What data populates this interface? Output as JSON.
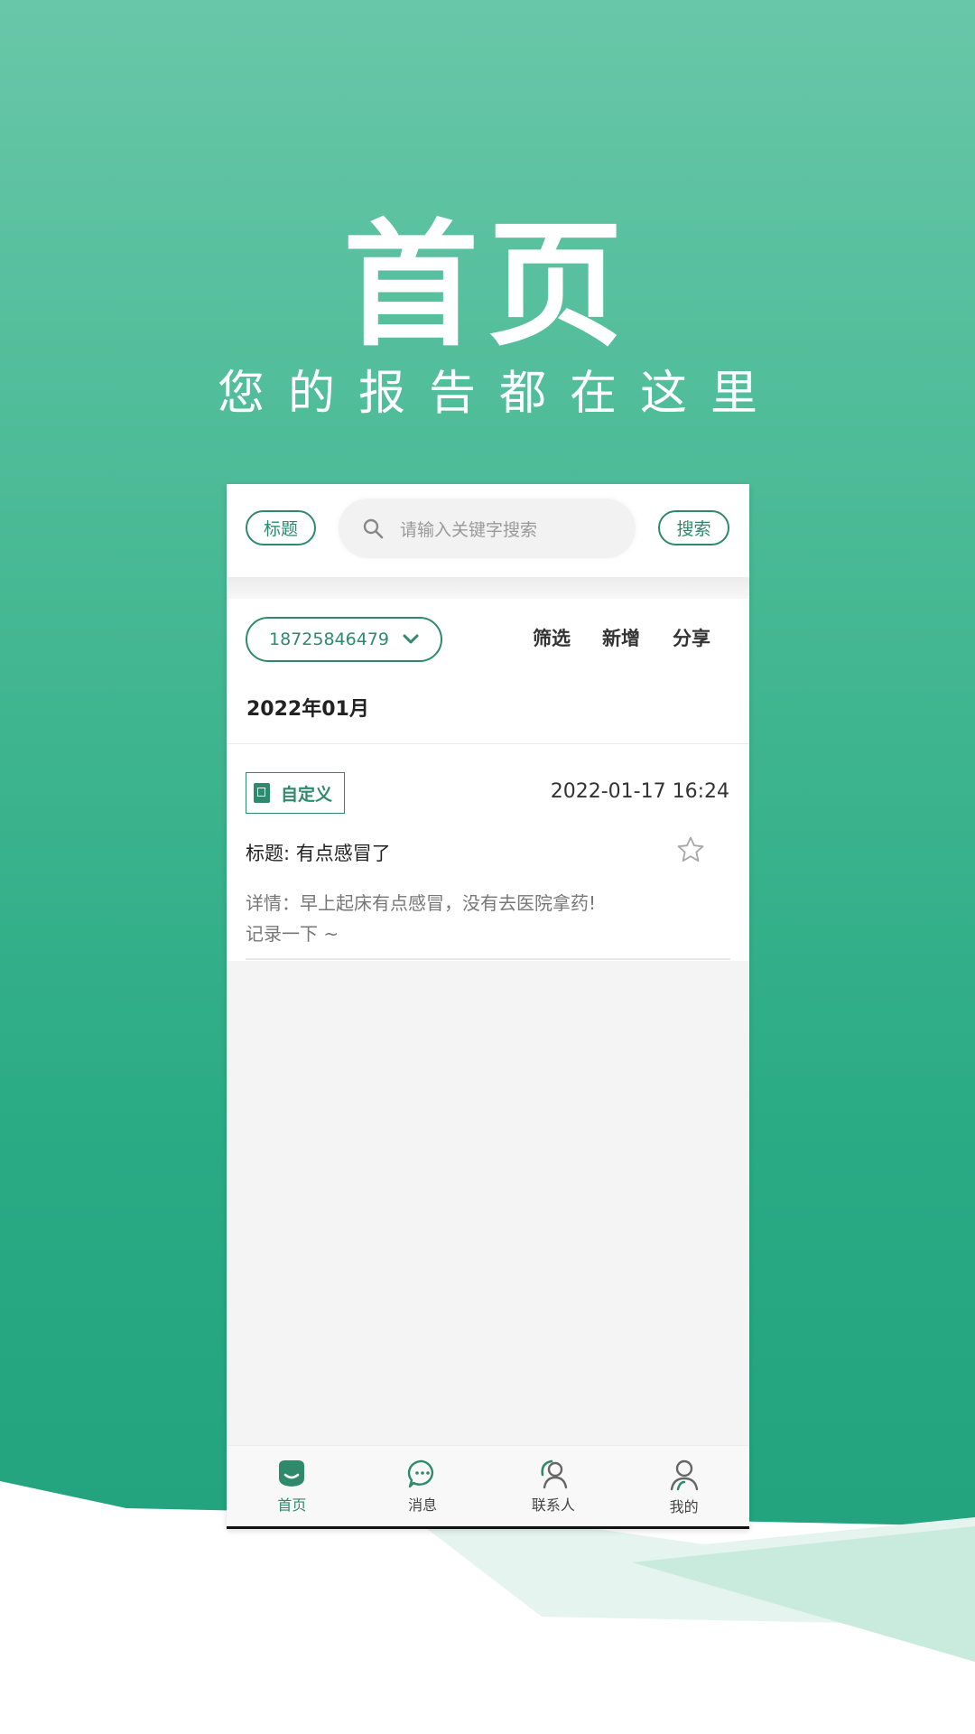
{
  "hero": {
    "title": "首页",
    "subtitle": "您的报告都在这里"
  },
  "search_bar": {
    "title_button": "标题",
    "placeholder": "请输入关键字搜索",
    "search_button": "搜索"
  },
  "filter_bar": {
    "phone_number": "18725846479",
    "actions": [
      "筛选",
      "新增",
      "分享"
    ]
  },
  "month": "2022年01月",
  "record": {
    "tag": "自定义",
    "time": "2022-01-17 16:24",
    "title": "标题: 有点感冒了",
    "detail_line1": "详情：早上起床有点感冒，没有去医院拿药!",
    "detail_line2": "记录一下 ~",
    "starred": false
  },
  "tabs": [
    {
      "label": "首页",
      "icon": "home-face-icon",
      "active": true
    },
    {
      "label": "消息",
      "icon": "chat-bubble-icon",
      "active": false
    },
    {
      "label": "联系人",
      "icon": "contacts-icon",
      "active": false
    },
    {
      "label": "我的",
      "icon": "person-icon",
      "active": false
    }
  ],
  "colors": {
    "accent": "#2f8a6c",
    "background_top": "#68c7a8",
    "background_bottom": "#1f9f7b"
  }
}
